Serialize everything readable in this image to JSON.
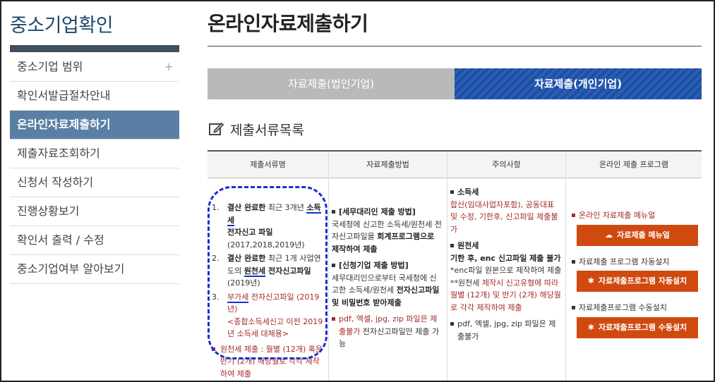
{
  "sidebar": {
    "title": "중소기업확인",
    "items": [
      {
        "label": "중소기업 범위",
        "plus": "+"
      },
      {
        "label": "확인서발급절차안내"
      },
      {
        "label": "온라인자료제출하기"
      },
      {
        "label": "제출자료조회하기"
      },
      {
        "label": "신청서 작성하기"
      },
      {
        "label": "진행상황보기"
      },
      {
        "label": "확인서 출력 / 수정"
      },
      {
        "label": "중소기업여부 알아보기"
      }
    ]
  },
  "main": {
    "title": "온라인자료제출하기",
    "tabs": [
      {
        "label": "자료제출(법인기업)"
      },
      {
        "label": "자료제출(개인기업)"
      }
    ],
    "section_title": "제출서류목록",
    "table": {
      "headers": [
        "제출서류명",
        "자료제출방법",
        "주의사항",
        "온라인 제출 프로그램"
      ],
      "col1": {
        "i1": {
          "num": "1.",
          "a": "결산 완료한",
          "b": " 최근 3개년 ",
          "c": "소득세",
          "d": "전자신고 파일",
          "e": "(2017,2018,2019년)"
        },
        "i2": {
          "num": "2.",
          "a": "결산 완료한",
          "b": " 최근 1개 사업연도의 ",
          "c": "원천세",
          "d": " 전자신고파일",
          "e": " (2019년)"
        },
        "i3": {
          "num": "3.",
          "a": "부가세",
          "b": " 전자신고파일 (2019년)",
          "c": "<종합소득세신고 이전 2019년 소득세 대체용>"
        },
        "note": "원천세 제출 : 월별 (12개) 혹은 반기 (2개) 해당월로 각각 제작하여 제출"
      },
      "col2": {
        "h1": "[세무대리인 제출 방법]",
        "p1a": "국세청에 신고한 소득세/원천세 전자신고파일을 ",
        "p1b": "회계프로그램으로 제작하여 제출",
        "h2": "[신청기업 제출 방법]",
        "p2a": "세무대리인으로부터 국세청에 신고한 소득세/원천세 ",
        "p2b": "전자신고파일 및 비밀번호 받아제출",
        "n1": "pdf, 엑셀, jpg, zip 파일은 제출불가",
        "n2": " 전자신고파일만 제출 가능"
      },
      "col3": {
        "h1": "소득세",
        "t1": "합산(임대사업자포함), 공동대표 및 수정, 기한후, 신고파일 제출불가",
        "h2": "원천세",
        "h2b": "기한 후, enc 신고파일 제출 불가",
        "t2": "*enc파일 원본으로 제작하여 제출",
        "t3a": "**원천세",
        "t3b": " 제작시 신고유형에 따라 월별 (12개) 및 반기 (2개) 해당월로 각각 제작하여 제출",
        "t4": "pdf, 엑셀, jpg, zip 파일은 제출불가"
      },
      "col4": {
        "l1": "온라인 자료제출 메뉴얼",
        "b1": "자료제출 메뉴얼",
        "l2": "자료제출 프로그램 자동설치",
        "b2": "자료제출프로그램 자동설치",
        "l3": "자료제출프로그램 수동설치",
        "b3": "자료제출프로그램 수동설치"
      }
    }
  },
  "colors": {
    "accent": "#1f4fa0",
    "brand_bar": "#3f4f5f",
    "active_menu": "#5a7fa5",
    "button": "#d04a10",
    "note_red": "#a52a2a",
    "highlight": "#1a2ecc"
  },
  "icons": {
    "section": "edit-icon",
    "manual": "cloud-icon",
    "install": "gear-icon"
  }
}
